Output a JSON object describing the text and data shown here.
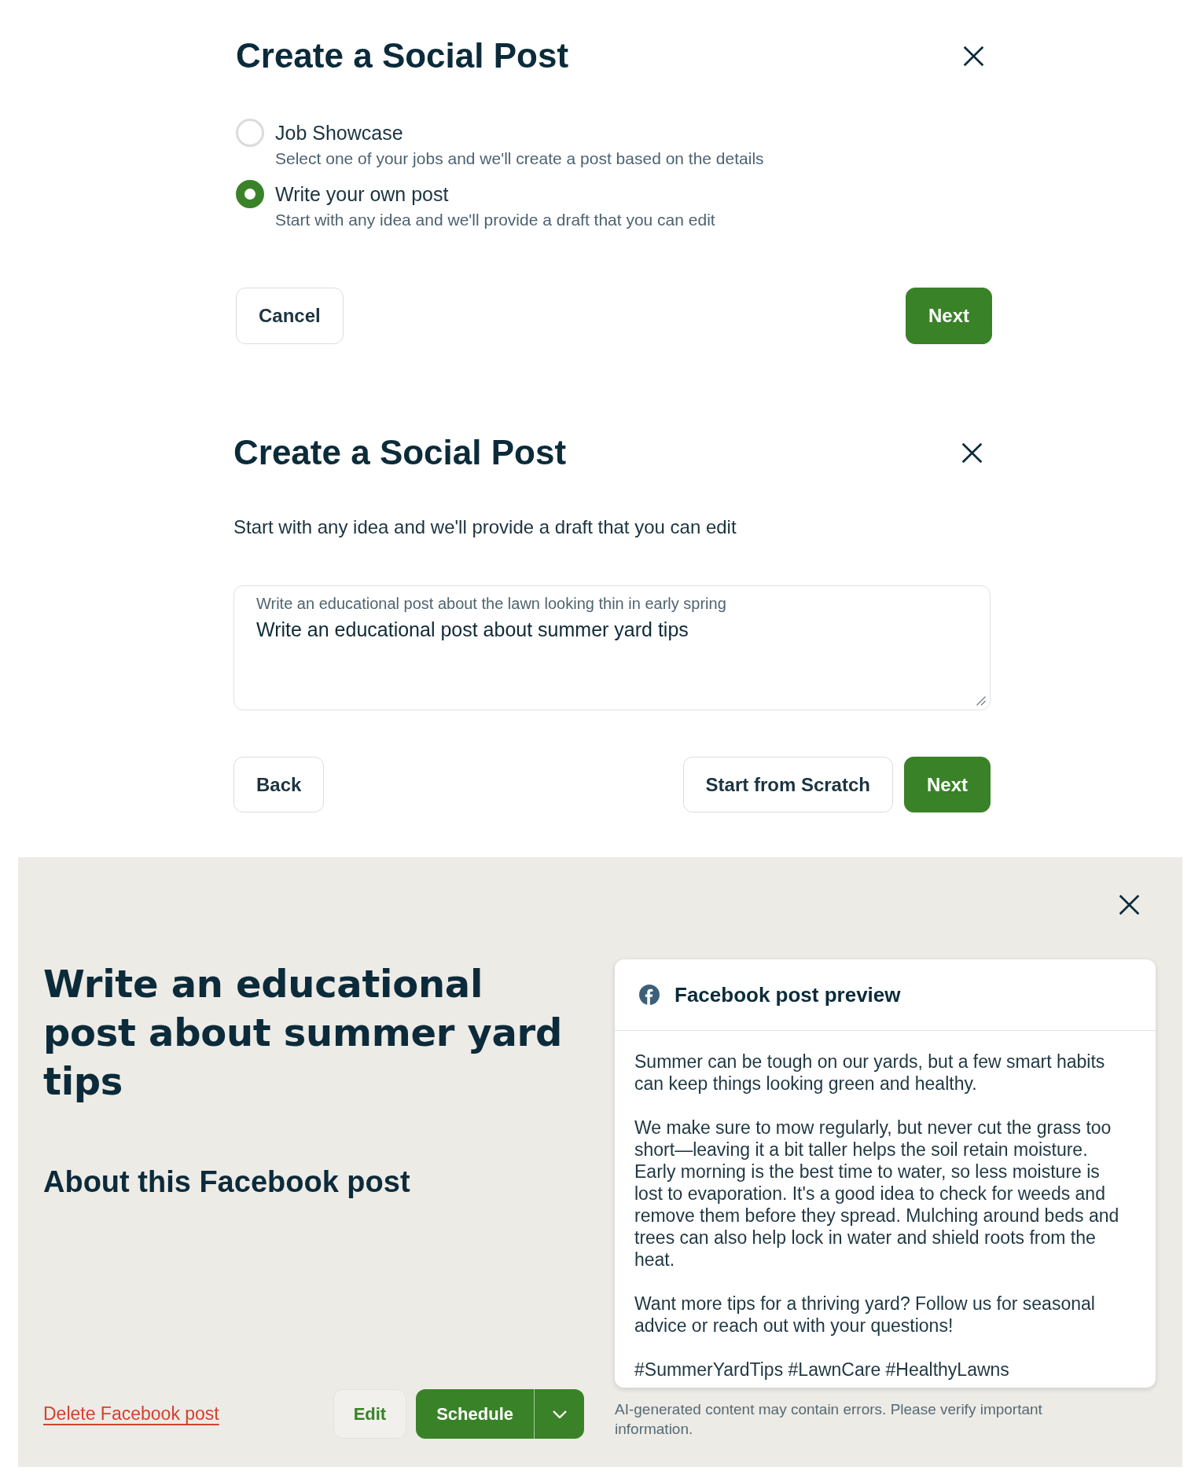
{
  "choose_dialog": {
    "title": "Create a Social Post",
    "options": [
      {
        "label": "Job Showcase",
        "description": "Select one of your jobs and we'll create a post based on the details",
        "selected": false
      },
      {
        "label": "Write your own post",
        "description": "Start with any idea and we'll provide a draft that you can edit",
        "selected": true
      }
    ],
    "footer": {
      "left": [
        {
          "kind": "secondary",
          "label": "Cancel"
        }
      ],
      "right": [
        {
          "kind": "primary",
          "label": "Next"
        }
      ]
    }
  },
  "prompt_dialog": {
    "title": "Create a Social Post",
    "subtitle": "Start with any idea and we'll provide a draft that you can edit",
    "prompt_field": {
      "label": "Write an educational post about the lawn looking thin in early spring",
      "value": "Write an educational post about summer yard tips"
    },
    "footer": {
      "left": [
        {
          "kind": "secondary",
          "label": "Back"
        }
      ],
      "right": [
        {
          "kind": "secondary",
          "label": "Start from Scratch"
        },
        {
          "kind": "primary",
          "label": "Next"
        }
      ]
    }
  },
  "review_panel": {
    "title": "Write an educational post about summer yard tips",
    "about_heading": "About this Facebook post",
    "actions": [
      {
        "kind": "link",
        "label": "Delete Facebook post"
      },
      {
        "kind": "tertiary",
        "label": "Edit"
      },
      {
        "kind": "split",
        "label": "Schedule"
      }
    ],
    "preview": {
      "title": "Facebook post preview",
      "paragraphs": [
        "Summer can be tough on our yards, but a few smart habits can keep things looking green and healthy.",
        "We make sure to mow regularly, but never cut the grass too short—leaving it a bit taller helps the soil retain moisture. Early morning is the best time to water, so less moisture is lost to evaporation. It's a good idea to check for weeds and remove them before they spread. Mulching around beds and trees can also help lock in water and shield roots from the heat.",
        "Want more tips for a thriving yard? Follow us for seasonal advice or reach out with your questions!",
        "#SummerYardTips #LawnCare #HealthyLawns"
      ]
    },
    "disclaimer": "AI-generated content may contain errors. Please verify important information."
  }
}
